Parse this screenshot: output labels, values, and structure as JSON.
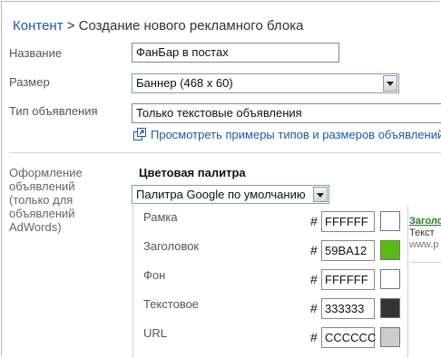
{
  "breadcrumb": {
    "link": "Контент",
    "separator": " > ",
    "current": "Создание нового рекламного блока"
  },
  "form": {
    "name_label": "Название",
    "name_value": "ФанБар в постах",
    "size_label": "Размер",
    "size_value": "Баннер (468 x 60)",
    "type_label": "Тип объявления",
    "type_value": "Только текстовые объявления",
    "examples_link": "Просмотреть примеры типов и размеров объявлений"
  },
  "style_section": {
    "label": "Оформление объявлений (только для объявлений AdWords)",
    "palette_title": "Цветовая палитра",
    "palette_value": "Палитра Google по умолчанию",
    "hash_symbol": "#",
    "colors": [
      {
        "label": "Рамка",
        "hex": "FFFFFF",
        "swatch": "#FFFFFF"
      },
      {
        "label": "Заголовок",
        "hex": "59BA12",
        "swatch": "#59BA12"
      },
      {
        "label": "Фон",
        "hex": "FFFFFF",
        "swatch": "#FFFFFF"
      },
      {
        "label": "Текстовое",
        "hex": "333333",
        "swatch": "#333333"
      },
      {
        "label": "URL",
        "hex": "CCCCCC",
        "swatch": "#CCCCCC"
      }
    ]
  },
  "preview": {
    "title": "Заголо",
    "text": "Текст",
    "url": "www.p"
  },
  "theme": {
    "link_color": "#2255aa",
    "border_color": "#888888"
  }
}
